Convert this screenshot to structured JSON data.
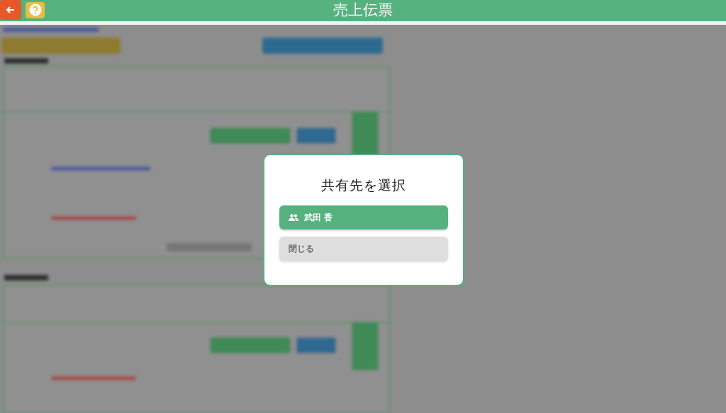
{
  "header": {
    "title": "売上伝票"
  },
  "dialog": {
    "title": "共有先を選択",
    "options": [
      {
        "kind": "person",
        "label": "武田 香"
      },
      {
        "kind": "close",
        "label": "閉じる"
      }
    ]
  }
}
